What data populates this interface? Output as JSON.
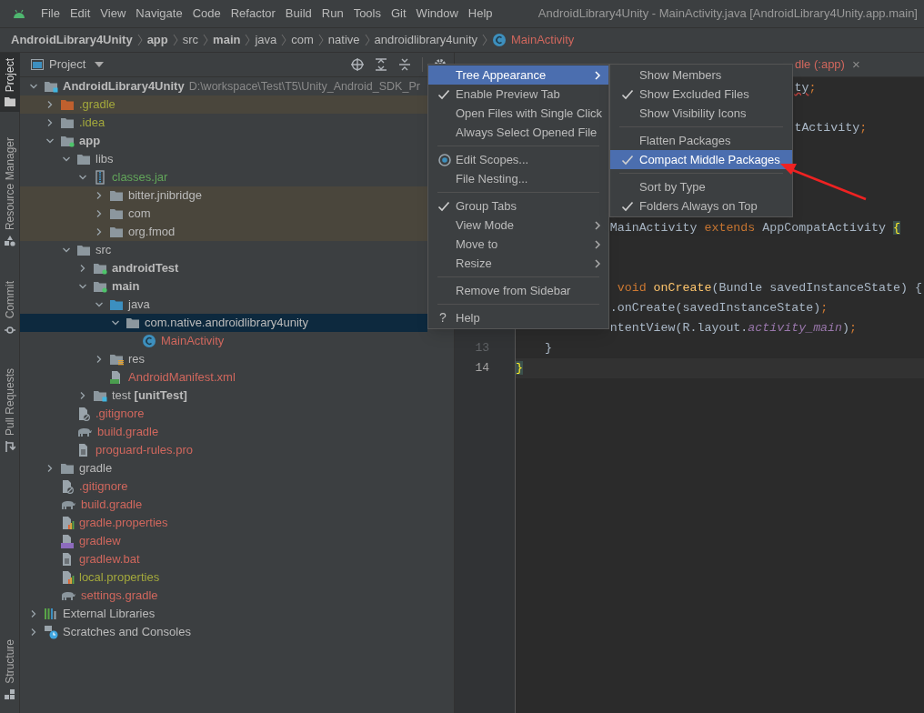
{
  "menu_bar": {
    "items": [
      "File",
      "Edit",
      "View",
      "Navigate",
      "Code",
      "Refactor",
      "Build",
      "Run",
      "Tools",
      "Git",
      "Window",
      "Help"
    ],
    "title": "AndroidLibrary4Unity - MainActivity.java [AndroidLibrary4Unity.app.main]"
  },
  "breadcrumb": [
    {
      "label": "AndroidLibrary4Unity",
      "bold": true,
      "kind": "text"
    },
    {
      "label": "app",
      "bold": true,
      "kind": "text"
    },
    {
      "label": "src",
      "bold": false,
      "kind": "text"
    },
    {
      "label": "main",
      "bold": true,
      "kind": "text"
    },
    {
      "label": "java",
      "bold": false,
      "kind": "text"
    },
    {
      "label": "com",
      "bold": false,
      "kind": "text"
    },
    {
      "label": "native",
      "bold": false,
      "kind": "text"
    },
    {
      "label": "androidlibrary4unity",
      "bold": false,
      "kind": "text"
    },
    {
      "label": "MainActivity",
      "bold": false,
      "kind": "class"
    }
  ],
  "tool_strip": [
    {
      "label": "Project",
      "selected": true,
      "kind": "folder"
    },
    {
      "label": "Resource Manager",
      "selected": false,
      "kind": "shapes"
    },
    {
      "label": "Commit",
      "selected": false,
      "kind": "commit"
    },
    {
      "label": "Pull Requests",
      "selected": false,
      "kind": "pull"
    },
    {
      "label": "Structure",
      "selected": false,
      "kind": "structure"
    }
  ],
  "project_panel": {
    "title": "Project",
    "tree": [
      {
        "label": "AndroidLibrary4Unity",
        "path": "D:\\workspace\\Test\\T5\\Unity_Android_SDK_Pr",
        "kind": "module-root",
        "bold": true,
        "color": "#bbbbbb",
        "excluded": false,
        "selected": false,
        "expanded": true,
        "children": [
          {
            "label": ".gradle",
            "kind": "excluded-folder",
            "bold": false,
            "color": "#a3a83c",
            "excluded": true,
            "selected": false,
            "expanded": false
          },
          {
            "label": ".idea",
            "kind": "folder",
            "bold": false,
            "color": "#a3a83c",
            "excluded": false,
            "selected": false,
            "expanded": false
          },
          {
            "label": "app",
            "kind": "module",
            "bold": true,
            "color": "#bbbbbb",
            "excluded": false,
            "selected": false,
            "expanded": true,
            "children": [
              {
                "label": "libs",
                "kind": "folder",
                "bold": false,
                "color": "#bbbbbb",
                "excluded": false,
                "selected": false,
                "expanded": true,
                "children": [
                  {
                    "label": "classes.jar",
                    "kind": "jar",
                    "bold": false,
                    "color": "#62a55a",
                    "excluded": false,
                    "selected": false,
                    "expanded": true,
                    "children": [
                      {
                        "label": "bitter.jnibridge",
                        "kind": "folder",
                        "bold": false,
                        "color": "#bbbbbb",
                        "excluded": true,
                        "selected": false,
                        "expanded": false
                      },
                      {
                        "label": "com",
                        "kind": "folder",
                        "bold": false,
                        "color": "#bbbbbb",
                        "excluded": true,
                        "selected": false,
                        "expanded": false
                      },
                      {
                        "label": "org.fmod",
                        "kind": "folder",
                        "bold": false,
                        "color": "#bbbbbb",
                        "excluded": true,
                        "selected": false,
                        "expanded": false
                      }
                    ]
                  }
                ]
              },
              {
                "label": "src",
                "kind": "folder",
                "bold": false,
                "color": "#bbbbbb",
                "excluded": false,
                "selected": false,
                "expanded": true,
                "children": [
                  {
                    "label": "androidTest",
                    "kind": "module",
                    "bold": true,
                    "color": "#bbbbbb",
                    "excluded": false,
                    "selected": false,
                    "expanded": false
                  },
                  {
                    "label": "main",
                    "kind": "module",
                    "bold": true,
                    "color": "#bbbbbb",
                    "excluded": false,
                    "selected": false,
                    "expanded": true,
                    "children": [
                      {
                        "label": "java",
                        "kind": "source-folder",
                        "bold": false,
                        "color": "#bbbbbb",
                        "excluded": false,
                        "selected": false,
                        "expanded": true,
                        "children": [
                          {
                            "label": "com.native.androidlibrary4unity",
                            "kind": "folder",
                            "bold": false,
                            "selected": true,
                            "expanded": true,
                            "children": [
                              {
                                "label": "MainActivity",
                                "kind": "class",
                                "bold": false,
                                "color": "#d0675d",
                                "excluded": false,
                                "selected": false
                              }
                            ]
                          }
                        ]
                      },
                      {
                        "label": "res",
                        "kind": "resources",
                        "bold": false,
                        "color": "#bbbbbb",
                        "excluded": false,
                        "selected": false,
                        "expanded": false
                      },
                      {
                        "label": "AndroidManifest.xml",
                        "kind": "manifest",
                        "bold": false,
                        "color": "#d0675d",
                        "excluded": false,
                        "selected": false
                      }
                    ]
                  },
                  {
                    "label": "test **[unitTest]**",
                    "kind": "test-module",
                    "bold": false,
                    "color": "#bbbbbb",
                    "excluded": false,
                    "selected": false,
                    "expanded": false
                  }
                ]
              },
              {
                "label": ".gitignore",
                "kind": "gitignore",
                "bold": false,
                "color": "#d0675d",
                "excluded": false,
                "selected": false
              },
              {
                "label": "build.gradle",
                "kind": "gradle",
                "bold": false,
                "color": "#d0675d",
                "excluded": false,
                "selected": false
              },
              {
                "label": "proguard-rules.pro",
                "kind": "text-file",
                "bold": false,
                "color": "#d0675d",
                "excluded": false,
                "selected": false
              }
            ]
          },
          {
            "label": "gradle",
            "kind": "folder",
            "bold": false,
            "color": "#bbbbbb",
            "excluded": false,
            "selected": false,
            "expanded": false
          },
          {
            "label": ".gitignore",
            "kind": "gitignore",
            "bold": false,
            "color": "#d0675d",
            "excluded": false,
            "selected": false
          },
          {
            "label": "build.gradle",
            "kind": "gradle",
            "bold": false,
            "color": "#d0675d",
            "excluded": false,
            "selected": false
          },
          {
            "label": "gradle.properties",
            "kind": "properties",
            "bold": false,
            "color": "#d0675d",
            "excluded": false,
            "selected": false
          },
          {
            "label": "gradlew",
            "kind": "shell",
            "bold": false,
            "color": "#d0675d",
            "excluded": false,
            "selected": false
          },
          {
            "label": "gradlew.bat",
            "kind": "text-file",
            "bold": false,
            "color": "#d0675d",
            "excluded": false,
            "selected": false
          },
          {
            "label": "local.properties",
            "kind": "properties",
            "bold": false,
            "color": "#a3a83c",
            "excluded": false,
            "selected": false
          },
          {
            "label": "settings.gradle",
            "kind": "gradle",
            "bold": false,
            "color": "#d0675d",
            "excluded": false,
            "selected": false
          }
        ]
      },
      {
        "label": "External Libraries",
        "kind": "libraries",
        "bold": false,
        "color": "#bbbbbb",
        "excluded": false,
        "selected": false,
        "expanded": false
      },
      {
        "label": "Scratches and Consoles",
        "kind": "scratches",
        "bold": false,
        "color": "#bbbbbb",
        "excluded": false,
        "selected": false,
        "expanded": false
      }
    ]
  },
  "editor": {
    "tab": {
      "label": "dle (:app)",
      "close": "×"
    },
    "lines": [
      {
        "tokens": [
          {
            "text": "ty",
            "kind": "error"
          },
          {
            "text": ";",
            "kind": "keyword"
          }
        ]
      },
      {
        "tokens": [
          {
            "text": "tActivity",
            "kind": "plain"
          },
          {
            "text": ";",
            "kind": "keyword"
          }
        ]
      },
      {
        "tokens": [
          {
            "text": "MainActivity ",
            "kind": "plain"
          },
          {
            "text": "extends ",
            "kind": "keyword"
          },
          {
            "text": "AppCompatActivity ",
            "kind": "plain"
          },
          {
            "text": "{",
            "kind": "brace-match"
          }
        ]
      },
      {
        "tokens": [
          {
            "text": "void ",
            "kind": "keyword"
          },
          {
            "text": "onCreate",
            "kind": "method"
          },
          {
            "text": "(Bundle savedInstanceState) {",
            "kind": "plain"
          }
        ]
      },
      {
        "tokens": [
          {
            "text": ".onCreate(savedInstanceState)",
            "kind": "plain"
          },
          {
            "text": ";",
            "kind": "keyword"
          }
        ]
      },
      {
        "tokens": [
          {
            "text": "ntentView(R.layout.",
            "kind": "plain"
          },
          {
            "text": "activity_main",
            "kind": "field"
          },
          {
            "text": ")",
            "kind": "plain"
          },
          {
            "text": ";",
            "kind": "keyword"
          }
        ]
      },
      {
        "number": "13",
        "current": false,
        "tokens": [
          {
            "text": "}",
            "kind": "plain"
          }
        ]
      },
      {
        "number": "14",
        "current": true,
        "tokens": [
          {
            "text": "}",
            "kind": "brace-match"
          }
        ]
      }
    ]
  },
  "context_menu": {
    "items": [
      {
        "kind": "item",
        "label": "Tree Appearance",
        "checked": false,
        "submenu": true,
        "selected": true
      },
      {
        "kind": "item",
        "label": "Enable Preview Tab",
        "checked": true,
        "submenu": false,
        "selected": false
      },
      {
        "kind": "item",
        "label": "Open Files with Single Click",
        "checked": false,
        "submenu": false,
        "selected": false
      },
      {
        "kind": "item",
        "label": "Always Select Opened File",
        "checked": false,
        "submenu": false,
        "selected": false
      },
      {
        "kind": "separator"
      },
      {
        "kind": "scope",
        "label": "Edit Scopes...",
        "checked": false,
        "submenu": false,
        "selected": false
      },
      {
        "kind": "item",
        "label": "File Nesting...",
        "checked": false,
        "submenu": false,
        "selected": false
      },
      {
        "kind": "separator"
      },
      {
        "kind": "item",
        "label": "Group Tabs",
        "checked": true,
        "submenu": false,
        "selected": false
      },
      {
        "kind": "item",
        "label": "View Mode",
        "checked": false,
        "submenu": true,
        "selected": false
      },
      {
        "kind": "item",
        "label": "Move to",
        "checked": false,
        "submenu": true,
        "selected": false
      },
      {
        "kind": "item",
        "label": "Resize",
        "checked": false,
        "submenu": true,
        "selected": false
      },
      {
        "kind": "separator"
      },
      {
        "kind": "item",
        "label": "Remove from Sidebar",
        "checked": false,
        "submenu": false,
        "selected": false
      },
      {
        "kind": "separator"
      },
      {
        "kind": "help",
        "label": "Help",
        "glyph": "?",
        "checked": false,
        "submenu": false,
        "selected": false
      }
    ]
  },
  "submenu": {
    "items": [
      {
        "kind": "item",
        "label": "Show Members",
        "checked": false,
        "selected": false
      },
      {
        "kind": "item",
        "label": "Show Excluded Files",
        "checked": true,
        "selected": false
      },
      {
        "kind": "item",
        "label": "Show Visibility Icons",
        "checked": false,
        "selected": false
      },
      {
        "kind": "separator"
      },
      {
        "kind": "item",
        "label": "Flatten Packages",
        "checked": false,
        "selected": false
      },
      {
        "kind": "item",
        "label": "Compact Middle Packages",
        "checked": true,
        "selected": true
      },
      {
        "kind": "separator"
      },
      {
        "kind": "item",
        "label": "Sort by Type",
        "checked": false,
        "selected": false
      },
      {
        "kind": "item",
        "label": "Folders Always on Top",
        "checked": true,
        "selected": false
      }
    ]
  }
}
